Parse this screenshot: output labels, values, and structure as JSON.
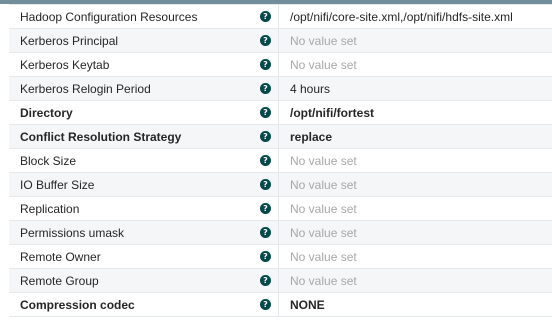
{
  "properties": {
    "rows": [
      {
        "name": "Hadoop Configuration Resources",
        "value": "/opt/nifi/core-site.xml,/opt/nifi/hdfs-site.xml",
        "required": false,
        "empty": false
      },
      {
        "name": "Kerberos Principal",
        "value": "No value set",
        "required": false,
        "empty": true
      },
      {
        "name": "Kerberos Keytab",
        "value": "No value set",
        "required": false,
        "empty": true
      },
      {
        "name": "Kerberos Relogin Period",
        "value": "4 hours",
        "required": false,
        "empty": false
      },
      {
        "name": "Directory",
        "value": "/opt/nifi/fortest",
        "required": true,
        "empty": false
      },
      {
        "name": "Conflict Resolution Strategy",
        "value": "replace",
        "required": true,
        "empty": false
      },
      {
        "name": "Block Size",
        "value": "No value set",
        "required": false,
        "empty": true
      },
      {
        "name": "IO Buffer Size",
        "value": "No value set",
        "required": false,
        "empty": true
      },
      {
        "name": "Replication",
        "value": "No value set",
        "required": false,
        "empty": true
      },
      {
        "name": "Permissions umask",
        "value": "No value set",
        "required": false,
        "empty": true
      },
      {
        "name": "Remote Owner",
        "value": "No value set",
        "required": false,
        "empty": true
      },
      {
        "name": "Remote Group",
        "value": "No value set",
        "required": false,
        "empty": true
      },
      {
        "name": "Compression codec",
        "value": "NONE",
        "required": true,
        "empty": false
      }
    ],
    "help_glyph": "?"
  },
  "colors": {
    "accent": "#004849",
    "placeholder": "#a8a8a8",
    "row_alt": "#f4f6f7",
    "border": "#e3e8eb"
  }
}
